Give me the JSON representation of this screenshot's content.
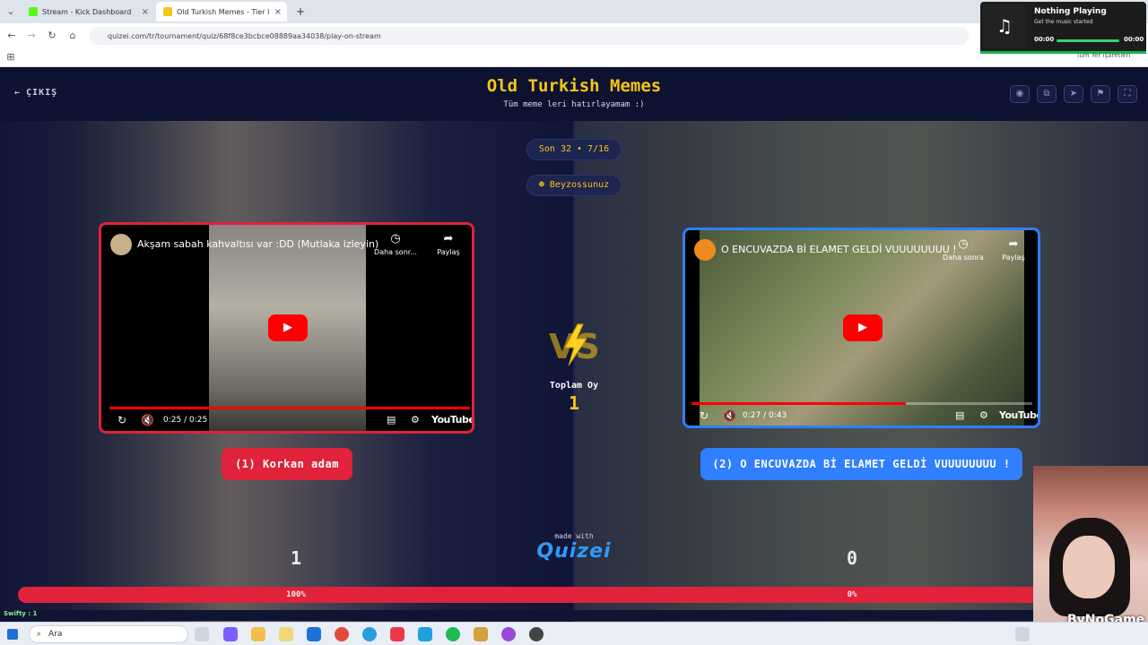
{
  "browser": {
    "tabs": [
      {
        "title": "Stream - Kick Dashboard",
        "favicon_color": "#53fc18"
      },
      {
        "title": "Old Turkish Memes - Tier l",
        "favicon_color": "#f5c518"
      }
    ],
    "new_tab_glyph": "+",
    "url": "quizei.com/tr/tournament/quiz/68f8ce3bcbce08889aa34038/play-on-stream",
    "bookmarks_label": "Tüm Yer İşaretleri"
  },
  "now_playing": {
    "title": "Nothing Playing",
    "subtitle": "Get the music started",
    "time_start": "00:00",
    "time_end": "00:00",
    "icon": "music-note-icon"
  },
  "quiz": {
    "exit_label": "ÇIKIŞ",
    "title": "Old Turkish Memes",
    "subtitle": "Tüm meme leri hatırlayamam :)",
    "round": "Son 32 • 7/16",
    "user": "Beyzossunuz",
    "total_votes_label": "Toplam Oy",
    "total_votes": "1",
    "made_with": "made with",
    "brand": "Quizei",
    "toolbar_icons": [
      "eye-icon",
      "external-icon",
      "send-icon",
      "flag-icon",
      "fullscreen-icon"
    ]
  },
  "left": {
    "video_title": "Akşam sabah kahvaltısı var :DD (Mutlaka izleyin)",
    "watch_later": "Daha sonr...",
    "share": "Paylaş",
    "time": "0:25 / 0:25",
    "progress": 1.0,
    "youtube": "YouTube",
    "choice": "(1) Korkan adam",
    "votes": "1",
    "percent": "100%",
    "color": "#e0223a"
  },
  "right": {
    "video_title": "O ENCUVAZDA Bİ ELAMET GELDİ VUUUUUUUU !",
    "watch_later": "Daha sonra",
    "share": "Paylaş",
    "time": "0:27 / 0:43",
    "progress": 0.628,
    "youtube": "YouTube",
    "choice": "(2) O ENCUVAZDA Bİ ELAMET GELDİ VUUUUUUUU !",
    "votes": "0",
    "percent": "0%",
    "color": "#2f7fff"
  },
  "stream": {
    "chat_line": "Swifty : 1",
    "watermark": "ByNoGame"
  },
  "taskbar": {
    "search_placeholder": "Ara"
  }
}
